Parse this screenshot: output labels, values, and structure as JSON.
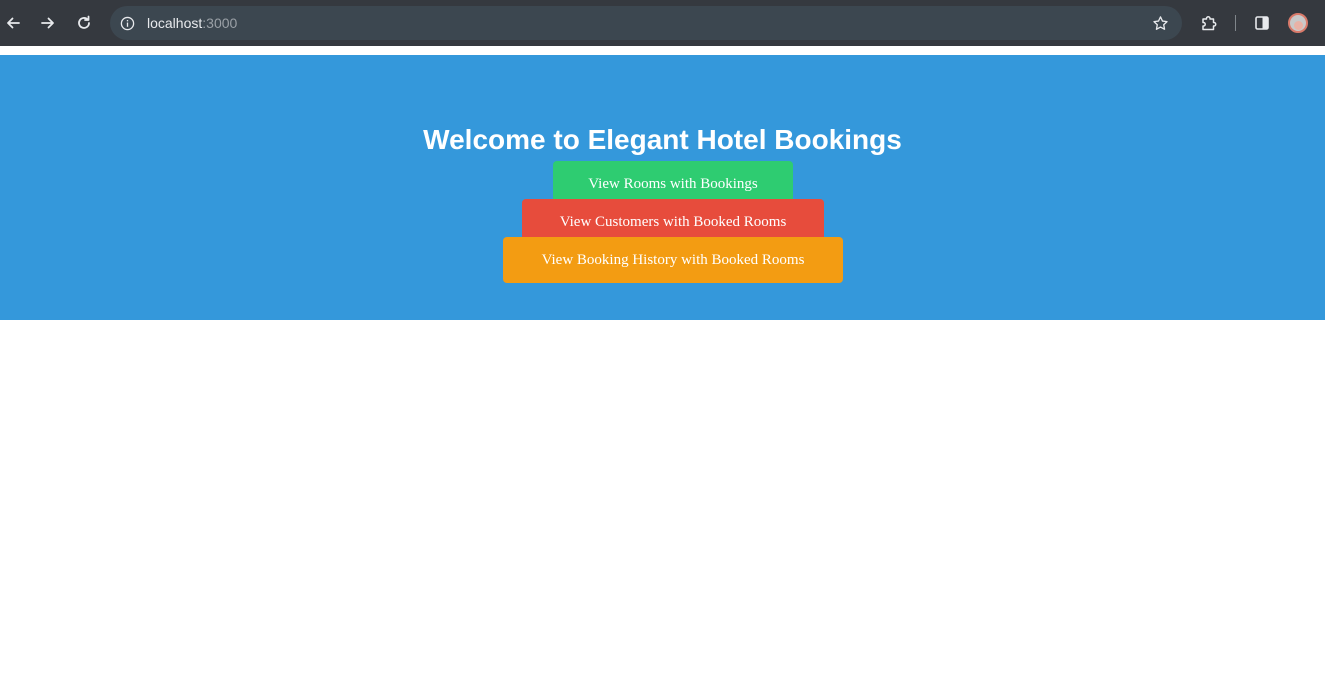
{
  "browser": {
    "url_host": "localhost",
    "url_port": ":3000",
    "icons": {
      "back": "arrow-left-icon",
      "forward": "arrow-right-icon",
      "reload": "reload-icon",
      "site_info": "info-icon",
      "bookmark": "star-icon",
      "extensions": "puzzle-icon",
      "side_panel": "side-panel-icon",
      "profile": "avatar"
    }
  },
  "hero": {
    "title": "Welcome to Elegant Hotel Bookings",
    "background": "#3498db",
    "buttons": [
      {
        "label": "View Rooms with Bookings",
        "color": "#2ecc71"
      },
      {
        "label": "View Customers with Booked Rooms",
        "color": "#e74c3c"
      },
      {
        "label": "View Booking History with Booked Rooms",
        "color": "#f39c12"
      }
    ]
  }
}
